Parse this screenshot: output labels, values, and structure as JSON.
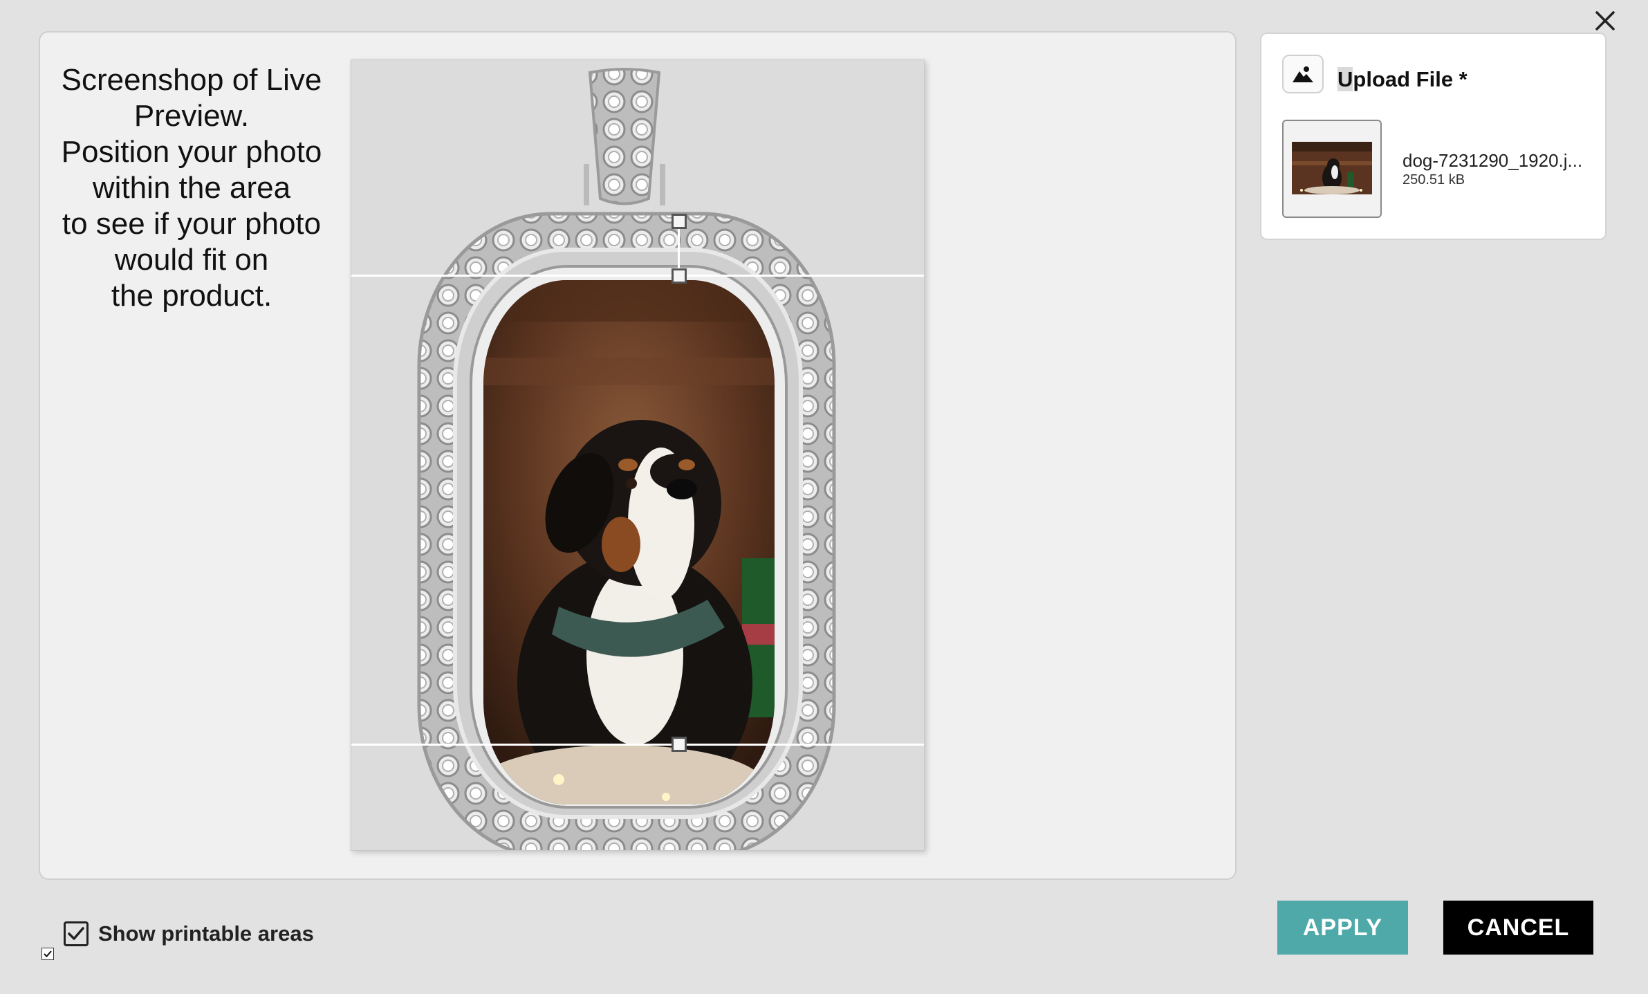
{
  "instructions": {
    "text": "Screenshop of Live\nPreview.\nPosition your photo\nwithin the area\nto see if your photo\nwould fit on\nthe product."
  },
  "upload": {
    "title_first_letter": "U",
    "title_rest": "pload File *",
    "icon": "image-mountain-icon",
    "file": {
      "name": "dog-7231290_1920.j...",
      "size": "250.51 kB"
    }
  },
  "options": {
    "show_printable_areas_label": "Show printable areas",
    "show_printable_areas_checked": true
  },
  "actions": {
    "apply_label": "APPLY",
    "cancel_label": "CANCEL"
  },
  "colors": {
    "apply": "#4fa9a9",
    "cancel": "#000000",
    "background": "#e2e2e2"
  }
}
